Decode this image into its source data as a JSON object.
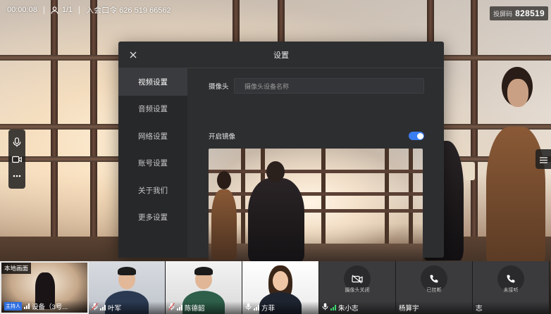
{
  "topbar": {
    "duration": "00:00:08",
    "participants": "1/1",
    "meeting_code": "入会口令 626 519 66562",
    "screen_code_label": "投屏码",
    "screen_code": "828519"
  },
  "settings": {
    "title": "设置",
    "menu": [
      {
        "label": "视频设置",
        "active": true
      },
      {
        "label": "音频设置",
        "active": false
      },
      {
        "label": "网络设置",
        "active": false
      },
      {
        "label": "账号设置",
        "active": false
      },
      {
        "label": "关于我们",
        "active": false
      },
      {
        "label": "更多设置",
        "active": false
      }
    ],
    "camera_label": "摄像头",
    "camera_placeholder": "摄像头设备名称",
    "mirror_label": "开启镜像",
    "mirror_on": true
  },
  "participants": [
    {
      "local_label": "本地画面",
      "host_badge": "主持人",
      "name": "设备（3号...",
      "type": "local"
    },
    {
      "name": "叶军",
      "type": "video"
    },
    {
      "name": "陈德韶",
      "type": "video"
    },
    {
      "name": "方菲",
      "type": "video"
    },
    {
      "name": "朱小志",
      "status": "摄像头关闭",
      "type": "camera-off"
    },
    {
      "name": "杨算宇",
      "status": "已挂断",
      "type": "hangup"
    },
    {
      "name": "志",
      "status": "未接听",
      "type": "hangup"
    }
  ],
  "colors": {
    "accent": "#3b7df2",
    "modal_bg": "#2d2e30",
    "host_badge": "#2f6fe0",
    "signal_green": "#3dd66f"
  }
}
